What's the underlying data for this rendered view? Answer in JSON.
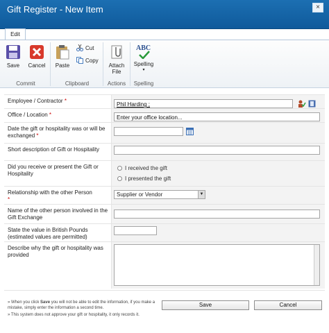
{
  "window": {
    "title": "Gift Register - New Item",
    "close": "×"
  },
  "ribbon": {
    "tab": "Edit",
    "save": "Save",
    "cancel": "Cancel",
    "paste": "Paste",
    "cut": "Cut",
    "copy": "Copy",
    "attach_line1": "Attach",
    "attach_line2": "File",
    "spelling": "Spelling",
    "spelling_icon_text": "ABC",
    "groups": {
      "commit": "Commit",
      "clipboard": "Clipboard",
      "actions": "Actions",
      "spelling": "Spelling"
    }
  },
  "form": {
    "employee": {
      "label": "Employee / Contractor",
      "value": "Phil Harding ;"
    },
    "office": {
      "label": "Office / Location",
      "placeholder": "Enter your office location..."
    },
    "date": {
      "label": "Date the gift or hospitality was or will be exchanged",
      "value": ""
    },
    "short_desc": {
      "label": "Short description of Gift or Hospitality",
      "value": ""
    },
    "received": {
      "label": "Did you receive or present the Gift or Hospitality",
      "options": [
        "I received the gift",
        "I presented the gift"
      ]
    },
    "relationship": {
      "label": "Relationship with the other Person",
      "value": "Supplier or Vendor"
    },
    "other_person": {
      "label": "Name of the other person involved in the Gift Exchange",
      "value": ""
    },
    "value": {
      "label": "State the value in British Pounds (estimated values are permitted)",
      "value": ""
    },
    "describe": {
      "label": "Describe why the gift or hospitality was provided",
      "value": ""
    }
  },
  "footer": {
    "note1_a": "» When you click ",
    "note1_b": "Save",
    "note1_c": " you will not be able to edit the information, if you make a mistake, simply enter the information a second time.",
    "note2": "» This system does not approve your gift or hospitality, it only records it.",
    "save": "Save",
    "cancel": "Cancel"
  },
  "colors": {
    "titlebar": "#1c6fb2",
    "required": "#cc0000"
  }
}
